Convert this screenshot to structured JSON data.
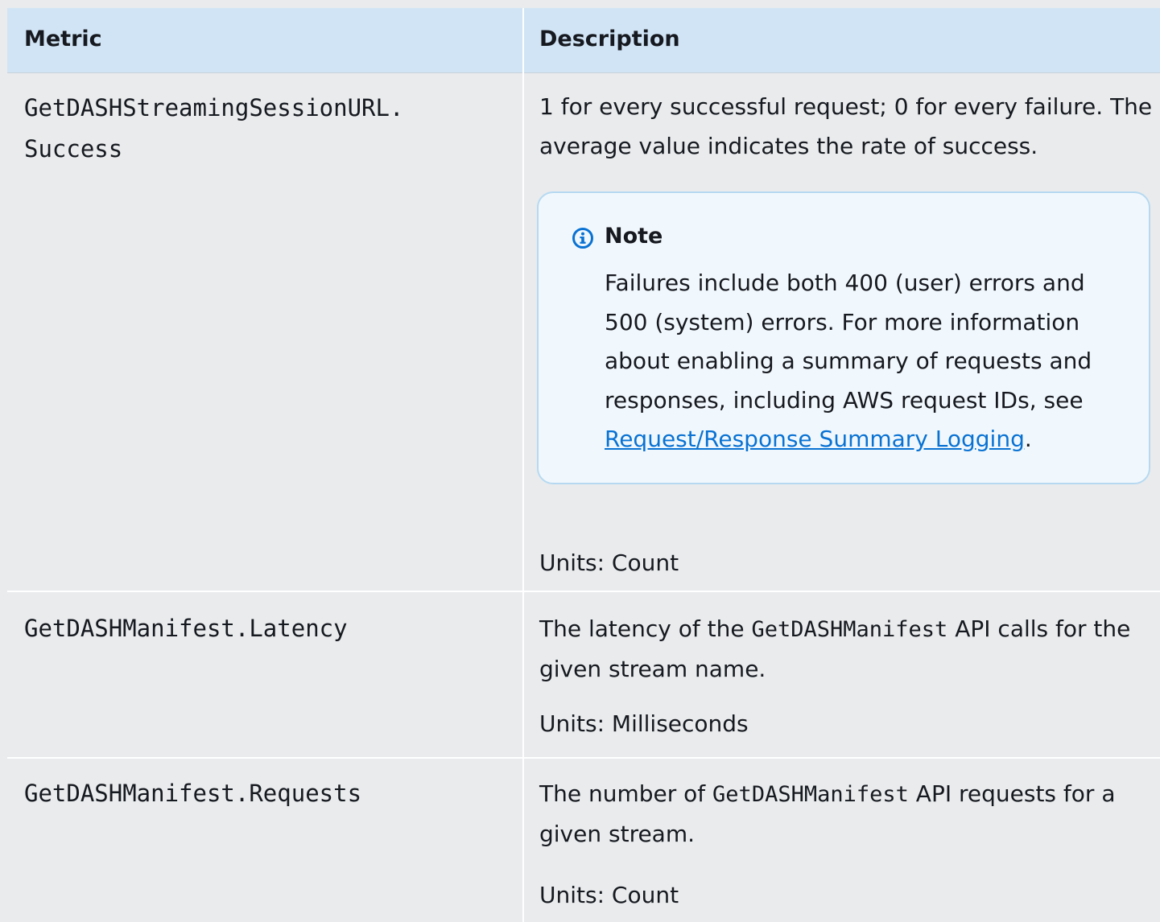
{
  "table": {
    "headers": {
      "metric": "Metric",
      "description": "Description"
    },
    "rows": [
      {
        "metric_line1": "GetDASHStreamingSessionURL.",
        "metric_line2": "Success",
        "description": "1 for every successful request; 0 for every failure. The average value indicates the rate of success.",
        "note": {
          "title": "Note",
          "body": "Failures include both 400 (user) errors and 500 (system) errors. For more information about enabling a summary of requests and responses, including AWS request IDs, see ",
          "link_text": "Request/Response Summary Logging",
          "body_end": "."
        },
        "units": "Units: Count"
      },
      {
        "metric": "GetDASHManifest.Latency",
        "description_before": "The latency of the ",
        "description_code": "GetDASHManifest",
        "description_after": " API calls for the given stream name.",
        "units": "Units: Milliseconds"
      },
      {
        "metric": "GetDASHManifest.Requests",
        "description_before": "The number of ",
        "description_code": "GetDASHManifest",
        "description_after": " API requests for a given stream.",
        "units": "Units: Count"
      }
    ]
  },
  "colors": {
    "header_bg": "#d1e4f5",
    "body_bg": "#e9ebed",
    "note_border": "#b6d9f1",
    "note_bg": "#f1f8fd",
    "link": "#0972d3",
    "info_icon": "#0972d3"
  },
  "icons": {
    "note_icon": "info-icon"
  }
}
